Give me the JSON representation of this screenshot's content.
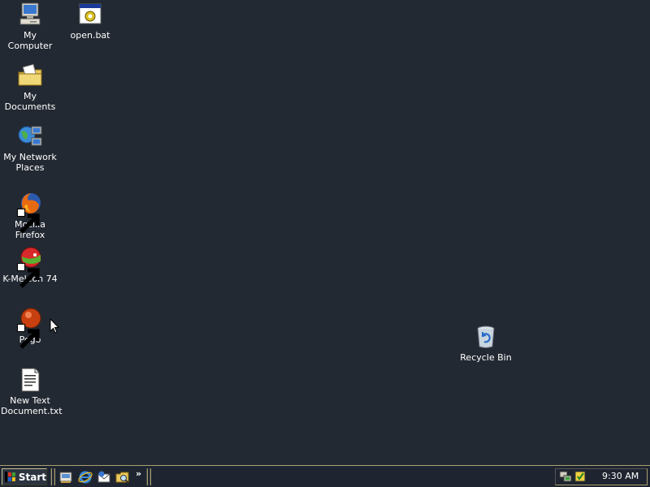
{
  "desktop": {
    "background": "#232932",
    "icons": [
      {
        "label": "My Computer",
        "icon": "my-computer-icon"
      },
      {
        "label": "open.bat",
        "icon": "batch-file-icon"
      },
      {
        "label": "My Documents",
        "icon": "my-documents-icon"
      },
      {
        "label": "My Network Places",
        "icon": "network-places-icon"
      },
      {
        "label": "Mozilla Firefox",
        "icon": "firefox-icon"
      },
      {
        "label": "K-Meleon 74",
        "icon": "k-meleon-icon"
      },
      {
        "label": "Pego",
        "icon": "pego-icon"
      },
      {
        "label": "New Text Document.txt",
        "icon": "text-document-icon"
      },
      {
        "label": "Recycle Bin",
        "icon": "recycle-bin-icon"
      }
    ]
  },
  "taskbar": {
    "start_label": "Start",
    "quick_launch": [
      "show-desktop-icon",
      "internet-explorer-icon",
      "outlook-express-icon",
      "windows-explorer-icon"
    ],
    "chevron": "»",
    "tray_icons": [
      "network-tray-icon",
      "security-tray-icon"
    ],
    "clock": "9:30 AM"
  }
}
